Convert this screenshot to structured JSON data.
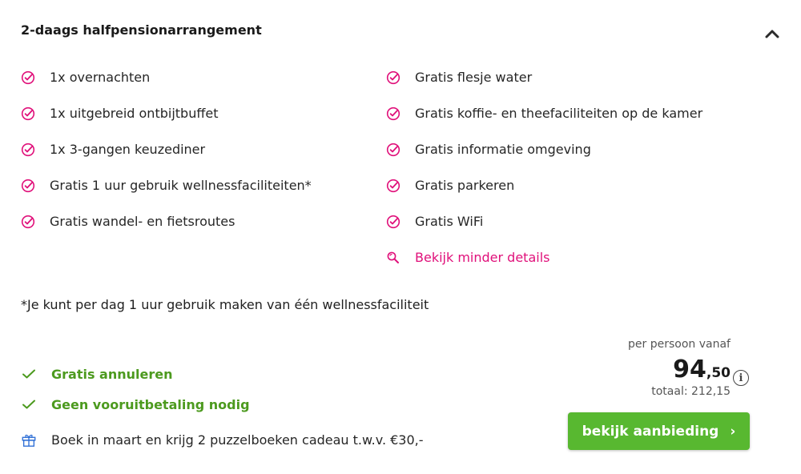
{
  "package": {
    "title": "2-daags halfpensionarrangement",
    "collapse_icon": "chevron-up-icon"
  },
  "features": {
    "left": [
      "1x overnachten",
      "1x uitgebreid ontbijtbuffet",
      "1x 3-gangen keuzediner",
      "Gratis 1 uur gebruik wellnessfaciliteiten*",
      "Gratis wandel- en fietsroutes"
    ],
    "right": [
      "Gratis flesje water",
      "Gratis koffie- en theefaciliteiten op de kamer",
      "Gratis informatie omgeving",
      "Gratis parkeren",
      "Gratis WiFi"
    ],
    "toggle_link": "Bekijk minder details",
    "check_icon": "check-circle-icon",
    "toggle_icon": "magnifier-icon"
  },
  "note": "*Je kunt per dag 1 uur gebruik maken van één wellnessfaciliteit",
  "perks": {
    "free_cancel": "Gratis annuleren",
    "no_prepay": "Geen vooruitbetaling nodig",
    "promo": "Boek in maart en krijg 2 puzzelboeken cadeau t.w.v. €30,-",
    "promo_icon": "gift-icon"
  },
  "price": {
    "label": "per persoon vanaf",
    "integer": "94",
    "decimals": ",50",
    "total": "totaal: 212,15",
    "info_icon": "i"
  },
  "cta": {
    "label": "bekijk aanbieding",
    "chevron": "›"
  },
  "colors": {
    "accent_pink": "#e0107a",
    "green_text": "#4c9a1e",
    "green_button": "#58b830"
  }
}
